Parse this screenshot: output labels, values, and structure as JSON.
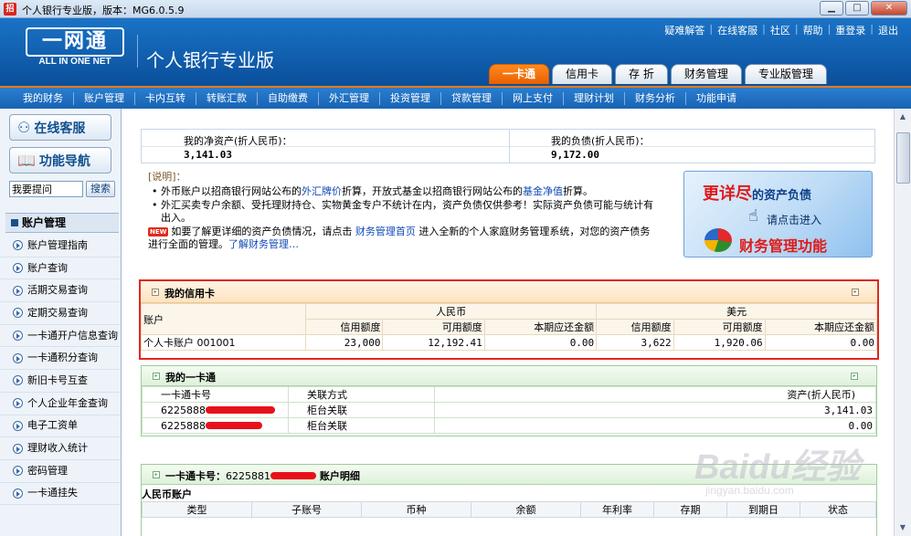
{
  "window": {
    "title": "个人银行专业版，版本：MG6.0.5.9",
    "icon": "app-icon"
  },
  "header": {
    "logo_main": "一网通",
    "logo_sub": "ALL IN ONE NET",
    "product_name": "个人银行专业版",
    "top_links": [
      "疑难解答",
      "在线客服",
      "社区",
      "帮助",
      "重登录",
      "退出"
    ],
    "main_tabs": [
      "一卡通",
      "信用卡",
      "存 折",
      "财务管理",
      "专业版管理"
    ],
    "active_tab": "一卡通"
  },
  "nav": [
    "我的财务",
    "账户管理",
    "卡内互转",
    "转账汇款",
    "自助缴费",
    "外汇管理",
    "投资管理",
    "贷款管理",
    "网上支付",
    "理财计划",
    "财务分析",
    "功能申请"
  ],
  "sidebar": {
    "service_btn": "在线客服",
    "guide_btn": "功能导航",
    "help_placeholder": "我要提问",
    "search_btn": "搜索",
    "section_title": "账户管理",
    "items": [
      "账户管理指南",
      "账户查询",
      "活期交易查询",
      "定期交易查询",
      "一卡通开户信息查询",
      "一卡通积分查询",
      "新旧卡号互查",
      "个人企业年金查询",
      "电子工资单",
      "理财收入统计",
      "密码管理",
      "一卡通挂失"
    ]
  },
  "summary": {
    "net_assets_label": "我的净资产(折人民币)：",
    "net_assets_value": "3,141.03",
    "liabilities_label": "我的负债(折人民币)：",
    "liabilities_value": "9,172.00"
  },
  "notes": {
    "heading": "[说明]：",
    "line1_a": "外币账户以招商银行网站公布的",
    "line1_link1": "外汇牌价",
    "line1_b": "折算，开放式基金以招商银行网站公布的",
    "line1_link2": "基金净值",
    "line1_c": "折算。",
    "line2": "外汇买卖专户余额、受托理财持仓、实物黄金专户不统计在内，资产负债仅供参考！实际资产负债可能与统计有出入。",
    "new_badge": "NEW",
    "line3_a": "如要了解更详细的资产负债情况，请点击",
    "line3_link1": "财务管理首页",
    "line3_b": "进入全新的个人家庭财务管理系统，对您的资产债务进行全面的管理。",
    "line3_link2": "了解财务管理…"
  },
  "promo": {
    "title_main": "更详尽",
    "title_rest": "的资产负债",
    "cta": "请点击进入",
    "bottom": "财务管理功能"
  },
  "credit_card": {
    "title": "我的信用卡",
    "col_account": "账户",
    "group_rmb": "人民币",
    "group_usd": "美元",
    "sub_headers": [
      "信用额度",
      "可用额度",
      "本期应还金额",
      "信用额度",
      "可用额度",
      "本期应还金额"
    ],
    "row": {
      "account": "个人卡账户 001001",
      "rmb_credit": "23,000",
      "rmb_available": "12,192.41",
      "rmb_due": "0.00",
      "usd_credit": "3,622",
      "usd_available": "1,920.06",
      "usd_due": "0.00"
    }
  },
  "yikatong": {
    "title": "我的一卡通",
    "headers": [
      "一卡通卡号",
      "关联方式",
      "资产(折人民币)"
    ],
    "rows": [
      {
        "card_prefix": "6225888",
        "link": "柜台关联",
        "assets": "3,141.03"
      },
      {
        "card_prefix": "6225888",
        "link": "柜台关联",
        "assets": "0.00"
      }
    ]
  },
  "detail": {
    "title_prefix": "一卡通卡号：",
    "card_prefix": "6225881",
    "title_suffix": "账户明细",
    "rmb_label": "人民币账户",
    "headers": [
      "类型",
      "子账号",
      "币种",
      "余额",
      "年利率",
      "存期",
      "到期日",
      "状态"
    ]
  },
  "watermark": {
    "line1": "Baidu经验",
    "line2": "jingyan.baidu.com"
  },
  "colors": {
    "header_blue": "#0a4f9b",
    "accent_orange": "#ff7a00",
    "highlight_red": "#e0281e"
  }
}
